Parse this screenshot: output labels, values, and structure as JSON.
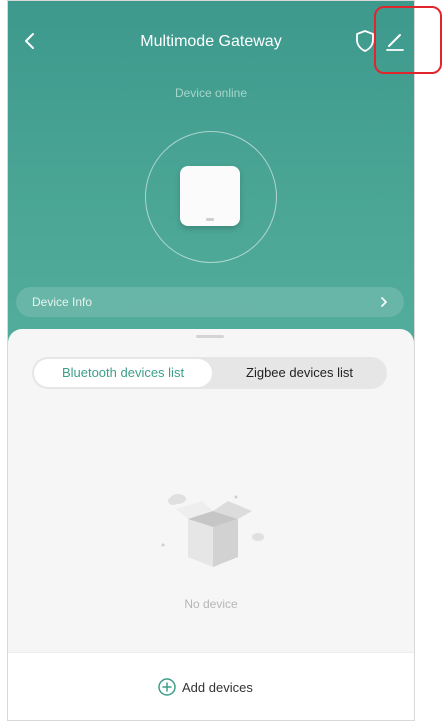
{
  "header": {
    "title": "Multimode Gateway",
    "status": "Device online",
    "info_label": "Device Info"
  },
  "tabs": [
    {
      "label": "Bluetooth devices list",
      "active": true
    },
    {
      "label": "Zigbee devices list",
      "active": false
    }
  ],
  "empty_state": {
    "text": "No device"
  },
  "footer": {
    "add_label": "Add devices"
  },
  "icons": {
    "back": "chevron-left-icon",
    "security": "shield-icon",
    "edit": "pencil-icon",
    "info": "chevron-right-icon",
    "add": "plus-circle-icon"
  },
  "colors": {
    "header": "#4aa595",
    "accent": "#3d9f89",
    "highlight": "#e0252f"
  }
}
